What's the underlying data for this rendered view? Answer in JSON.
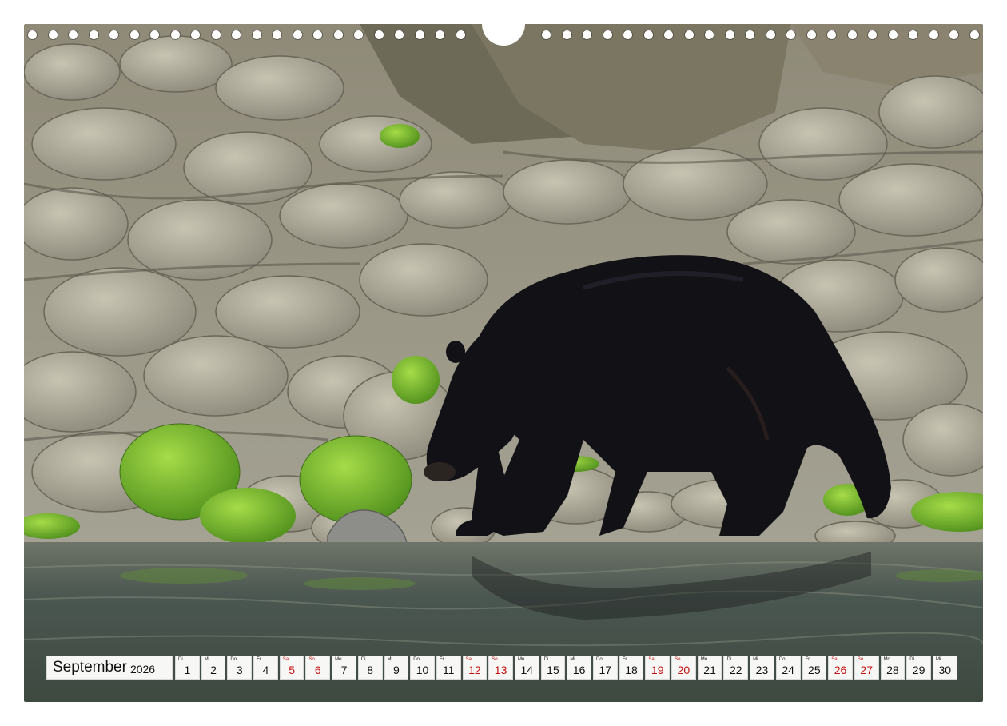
{
  "calendar": {
    "month": "September",
    "year": "2026",
    "days": [
      {
        "dow": "Di",
        "num": "1",
        "weekend": false
      },
      {
        "dow": "Mi",
        "num": "2",
        "weekend": false
      },
      {
        "dow": "Do",
        "num": "3",
        "weekend": false
      },
      {
        "dow": "Fr",
        "num": "4",
        "weekend": false
      },
      {
        "dow": "Sa",
        "num": "5",
        "weekend": true
      },
      {
        "dow": "So",
        "num": "6",
        "weekend": true
      },
      {
        "dow": "Mo",
        "num": "7",
        "weekend": false
      },
      {
        "dow": "Di",
        "num": "8",
        "weekend": false
      },
      {
        "dow": "Mi",
        "num": "9",
        "weekend": false
      },
      {
        "dow": "Do",
        "num": "10",
        "weekend": false
      },
      {
        "dow": "Fr",
        "num": "11",
        "weekend": false
      },
      {
        "dow": "Sa",
        "num": "12",
        "weekend": true
      },
      {
        "dow": "So",
        "num": "13",
        "weekend": true
      },
      {
        "dow": "Mo",
        "num": "14",
        "weekend": false
      },
      {
        "dow": "Di",
        "num": "15",
        "weekend": false
      },
      {
        "dow": "Mi",
        "num": "16",
        "weekend": false
      },
      {
        "dow": "Do",
        "num": "17",
        "weekend": false
      },
      {
        "dow": "Fr",
        "num": "18",
        "weekend": false
      },
      {
        "dow": "Sa",
        "num": "19",
        "weekend": true
      },
      {
        "dow": "So",
        "num": "20",
        "weekend": true
      },
      {
        "dow": "Mo",
        "num": "21",
        "weekend": false
      },
      {
        "dow": "Di",
        "num": "22",
        "weekend": false
      },
      {
        "dow": "Mi",
        "num": "23",
        "weekend": false
      },
      {
        "dow": "Do",
        "num": "24",
        "weekend": false
      },
      {
        "dow": "Fr",
        "num": "25",
        "weekend": false
      },
      {
        "dow": "Sa",
        "num": "26",
        "weekend": true
      },
      {
        "dow": "So",
        "num": "27",
        "weekend": true
      },
      {
        "dow": "Mo",
        "num": "28",
        "weekend": false
      },
      {
        "dow": "Di",
        "num": "29",
        "weekend": false
      },
      {
        "dow": "Mi",
        "num": "30",
        "weekend": false
      }
    ]
  },
  "colors": {
    "weekend": "#c41010",
    "text": "#111111",
    "rock": "#9c9a8c",
    "moss": "#6fb52c",
    "bear": "#121116",
    "water": "#4e5a52"
  },
  "scene": {
    "subject": "black-bear",
    "icon": "bear-icon"
  }
}
